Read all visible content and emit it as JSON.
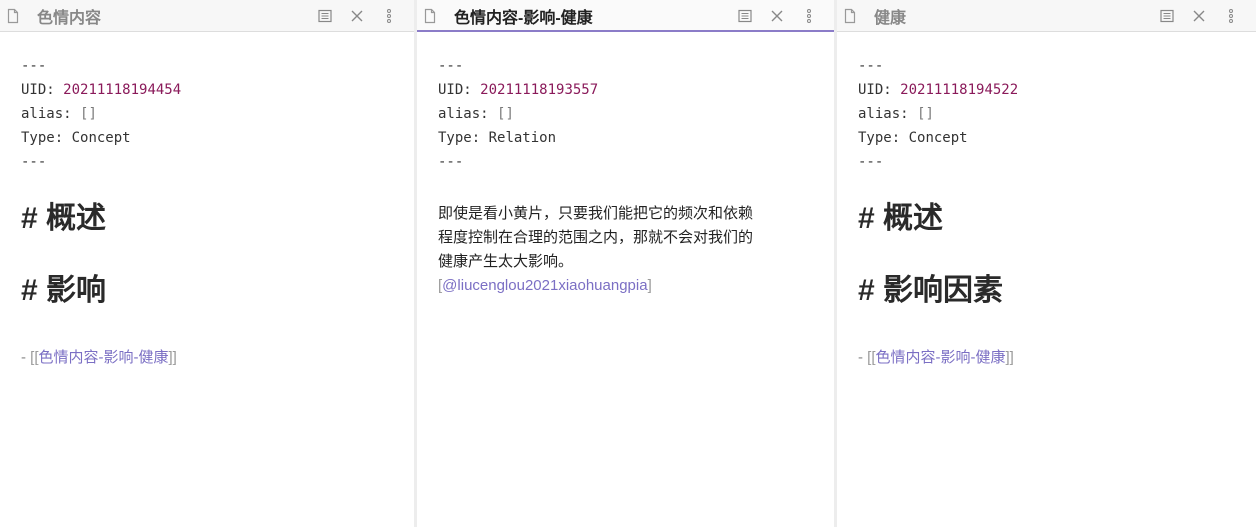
{
  "panes": [
    {
      "title": "色情内容",
      "frontmatter": {
        "dashes": "---",
        "uid_key": "UID:",
        "uid_value": "20211118194454",
        "alias_key": "alias:",
        "alias_value": "[]",
        "type_key": "Type:",
        "type_value": "Concept"
      },
      "heading1": "# 概述",
      "heading2": "# 影响",
      "list_prefix": "- ",
      "link_open": "[[",
      "link_text": "色情内容-影响-健康",
      "link_close": "]]"
    },
    {
      "title": "色情内容-影响-健康",
      "frontmatter": {
        "dashes": "---",
        "uid_key": "UID:",
        "uid_value": "20211118193557",
        "alias_key": "alias:",
        "alias_value": "[]",
        "type_key": "Type:",
        "type_value": "Relation"
      },
      "paragraph_lines": [
        "即使是看小黄片，只要我们能把它的频次和依赖",
        "程度控制在合理的范围之内，那就不会对我们的",
        "健康产生太大影响。"
      ],
      "cite_open": "[",
      "cite_text": "@liucenglou2021xiaohuangpia",
      "cite_close": "]"
    },
    {
      "title": "健康",
      "frontmatter": {
        "dashes": "---",
        "uid_key": "UID:",
        "uid_value": "20211118194522",
        "alias_key": "alias:",
        "alias_value": "[]",
        "type_key": "Type:",
        "type_value": "Concept"
      },
      "heading1": "# 概述",
      "heading2": "# 影响因素",
      "list_prefix": "- ",
      "link_open": "[[",
      "link_text": "色情内容-影响-健康",
      "link_close": "]]"
    }
  ],
  "icons": {
    "file": "file-icon",
    "reading_view": "book-icon",
    "close": "close-icon",
    "more": "more-options-icon"
  },
  "colors": {
    "accent": "#7b6fc4",
    "uid": "#8a1a5a",
    "active_underline": "#8b7cc8"
  }
}
